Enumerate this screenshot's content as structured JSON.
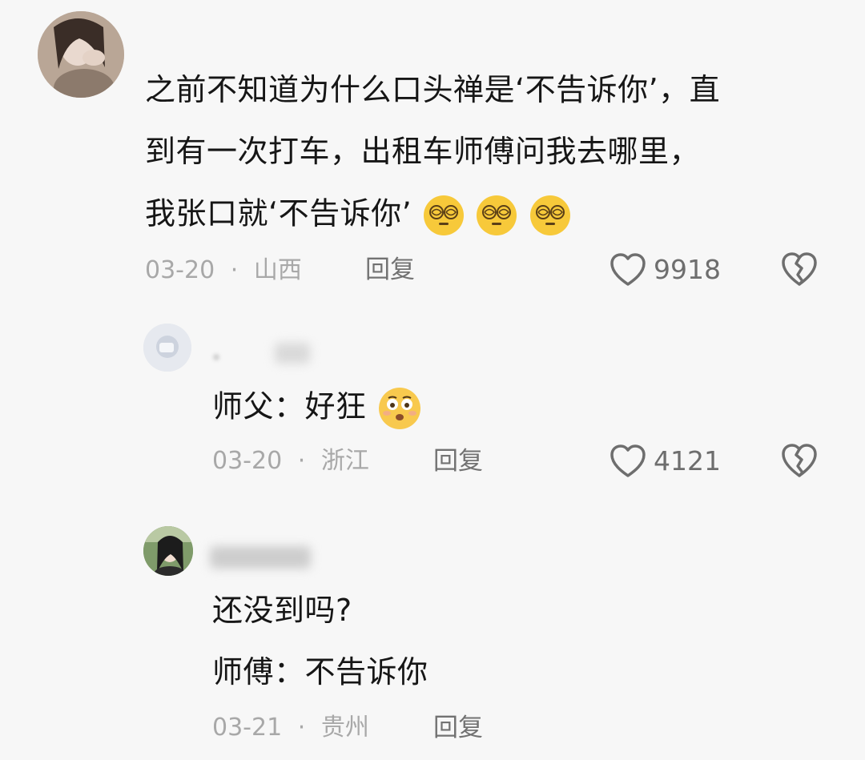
{
  "comments": [
    {
      "text_lines": [
        "之前不知道为什么口头禅是‘不告诉你’，直",
        "到有一次打车，出租车师傅问我去哪里，",
        "我张口就‘不告诉你’"
      ],
      "emoji_after_last_line": [
        "dizzy-face",
        "dizzy-face",
        "dizzy-face"
      ],
      "date": "03-20",
      "separator": "·",
      "location": "山西",
      "reply_label": "回复",
      "likes": "9918"
    },
    {
      "text_lines": [
        "师父：好狂"
      ],
      "emoji_after_last_line": [
        "pleading-face"
      ],
      "date": "03-20",
      "separator": "·",
      "location": "浙江",
      "reply_label": "回复",
      "likes": "4121"
    },
    {
      "text_lines": [
        "还没到吗?",
        "师傅：不告诉你"
      ],
      "date": "03-21",
      "separator": "·",
      "location": "贵州",
      "reply_label": "回复"
    }
  ],
  "icons": {
    "like": "heart-outline-icon",
    "dislike": "broken-heart-icon"
  },
  "colors": {
    "background": "#f7f7f7",
    "text": "#161616",
    "meta": "#a8a8a8",
    "action": "#6e6e6e"
  }
}
